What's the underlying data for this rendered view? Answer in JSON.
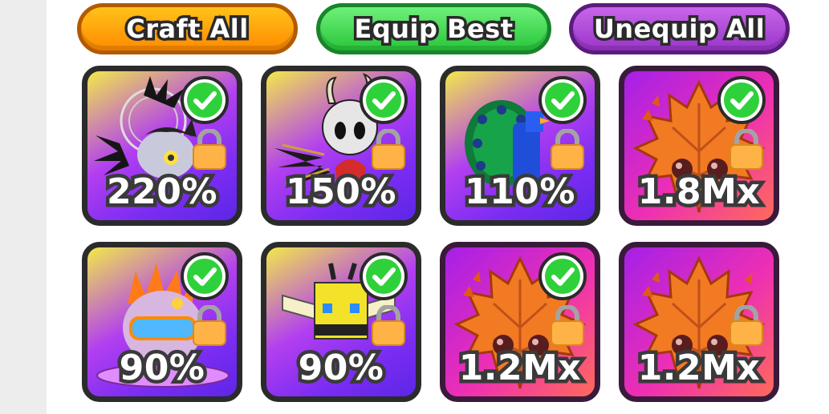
{
  "buttons": {
    "craft_all": "Craft All",
    "equip_best": "Equip Best",
    "unequip_all": "Unequip All"
  },
  "pets": [
    {
      "multiplier": "220%",
      "equipped": true,
      "locked": true,
      "pet_icon": "dark-spiky-bug-pet",
      "rarity": "basic"
    },
    {
      "multiplier": "150%",
      "equipped": true,
      "locked": true,
      "pet_icon": "horned-knight-pet",
      "rarity": "basic"
    },
    {
      "multiplier": "110%",
      "equipped": true,
      "locked": true,
      "pet_icon": "peacock-pet",
      "rarity": "basic"
    },
    {
      "multiplier": "1.8Mx",
      "equipped": true,
      "locked": true,
      "pet_icon": "autumn-leaf-pet",
      "rarity": "mythic"
    },
    {
      "multiplier": "90%",
      "equipped": true,
      "locked": true,
      "pet_icon": "goggles-blob-pet",
      "rarity": "basic"
    },
    {
      "multiplier": "90%",
      "equipped": true,
      "locked": true,
      "pet_icon": "bee-pet",
      "rarity": "basic"
    },
    {
      "multiplier": "1.2Mx",
      "equipped": true,
      "locked": true,
      "pet_icon": "autumn-leaf-pet",
      "rarity": "mythic"
    },
    {
      "multiplier": "1.2Mx",
      "equipped": false,
      "locked": true,
      "pet_icon": "autumn-leaf-pet",
      "rarity": "mythic"
    }
  ],
  "colors": {
    "craft": "#ff9c00",
    "equip": "#3ddb4c",
    "unequip": "#b04ee0",
    "check": "#2fd13a",
    "lock": "#ffb347"
  }
}
